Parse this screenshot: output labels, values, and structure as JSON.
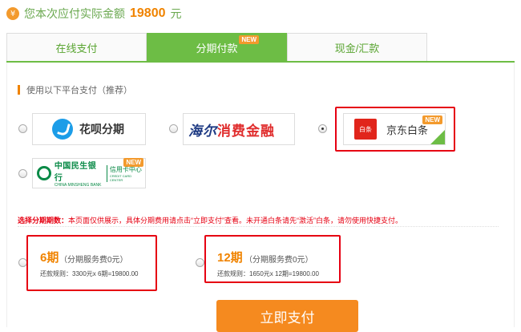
{
  "header": {
    "amount_prefix": "您本次应付实际金额",
    "amount_value": "19800",
    "amount_unit": "元"
  },
  "tabs": [
    {
      "label": "在线支付",
      "active": false
    },
    {
      "label": "分期付款",
      "active": true,
      "badge": "NEW"
    },
    {
      "label": "现金/汇款",
      "active": false
    }
  ],
  "section_title": "使用以下平台支付（推荐）",
  "platforms": {
    "huabei": {
      "label": "花呗分期",
      "selected": false
    },
    "haier": {
      "label_blue": "海尔",
      "label_red": "消费金融",
      "selected": false
    },
    "jd": {
      "logo_text": "白条",
      "label": "京东白条",
      "badge": "NEW",
      "selected": true
    },
    "minsheng": {
      "name_cn": "中国民生银行",
      "name_en": "CHINA MINSHENG BANK",
      "sub_cn": "信用卡中心",
      "sub_en": "CREDIT CARD CENTER",
      "badge": "NEW",
      "selected": false
    }
  },
  "notice": {
    "lead": "选择分期期数：",
    "text": "本页面仅供展示，具体分期费用请点击“立即支付”查看。未开通白条请先“激活”白条，请勿使用快捷支付。"
  },
  "periods": [
    {
      "title": "6期",
      "fee": "（分期服务费0元）",
      "rule": "还款规则：3300元x 6期=19800.00"
    },
    {
      "title": "12期",
      "fee": "（分期服务费0元）",
      "rule": "还款规则：1650元x 12期=19800.00"
    }
  ],
  "pay_button": "立即支付",
  "colors": {
    "accent_green": "#6dbd45",
    "accent_orange": "#f08300",
    "highlight_red": "#e60012"
  }
}
